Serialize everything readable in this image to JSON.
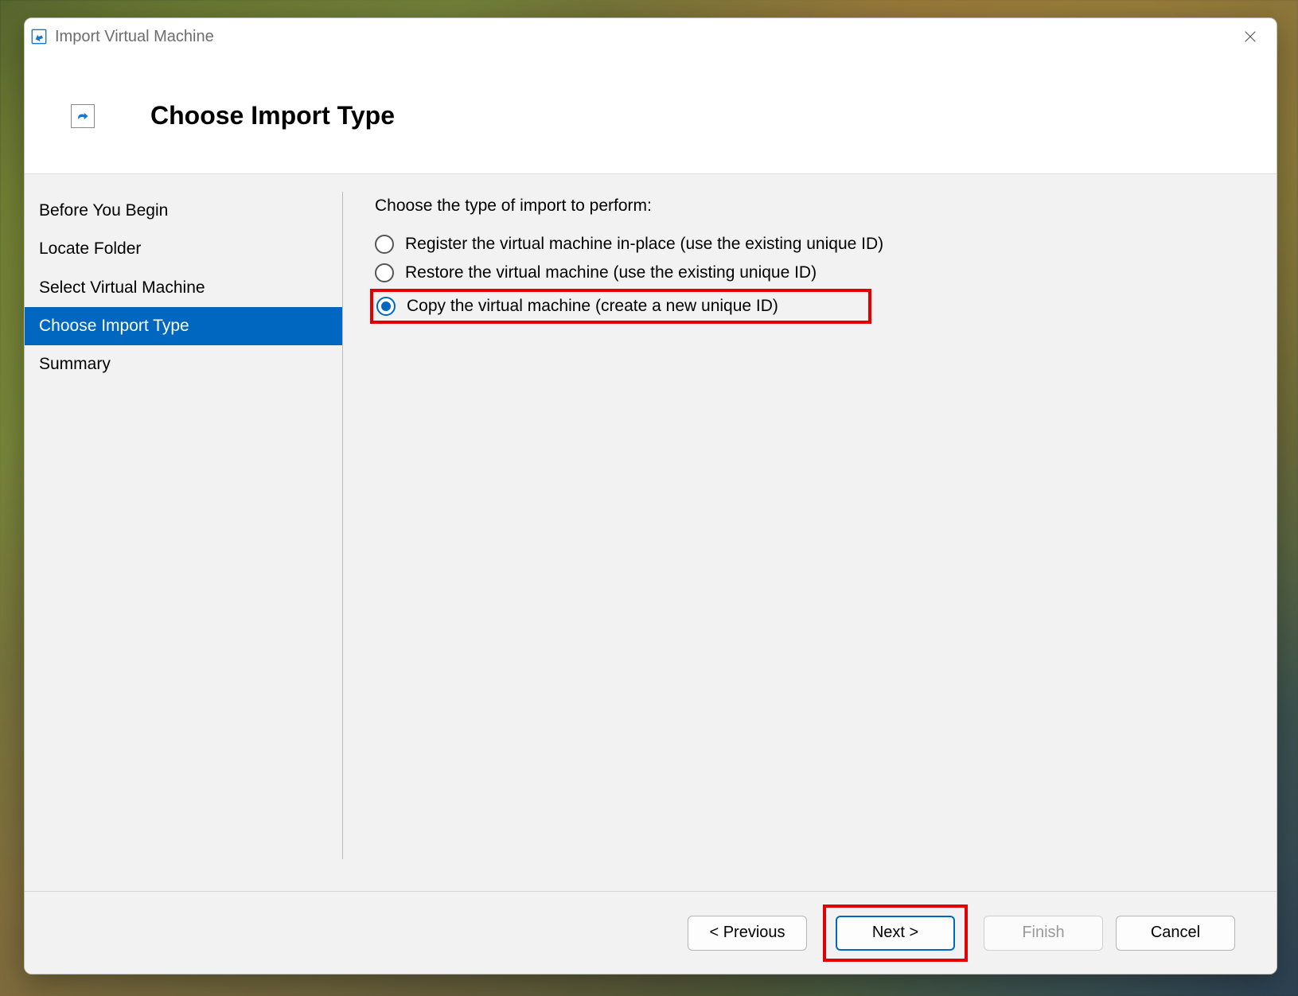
{
  "window": {
    "title": "Import Virtual Machine"
  },
  "header": {
    "page_title": "Choose Import Type"
  },
  "sidebar": {
    "steps": [
      {
        "label": "Before You Begin",
        "selected": false
      },
      {
        "label": "Locate Folder",
        "selected": false
      },
      {
        "label": "Select Virtual Machine",
        "selected": false
      },
      {
        "label": "Choose Import Type",
        "selected": true
      },
      {
        "label": "Summary",
        "selected": false
      }
    ]
  },
  "content": {
    "prompt": "Choose the type of import to perform:",
    "options": [
      {
        "label": "Register the virtual machine in-place (use the existing unique ID)",
        "checked": false,
        "highlighted": false
      },
      {
        "label": "Restore the virtual machine (use the existing unique ID)",
        "checked": false,
        "highlighted": false
      },
      {
        "label": "Copy the virtual machine (create a new unique ID)",
        "checked": true,
        "highlighted": true
      }
    ]
  },
  "footer": {
    "previous": "< Previous",
    "next": "Next >",
    "finish": "Finish",
    "cancel": "Cancel"
  },
  "annotation": {
    "highlight_color": "#e40000",
    "accent_color": "#0067c0"
  }
}
